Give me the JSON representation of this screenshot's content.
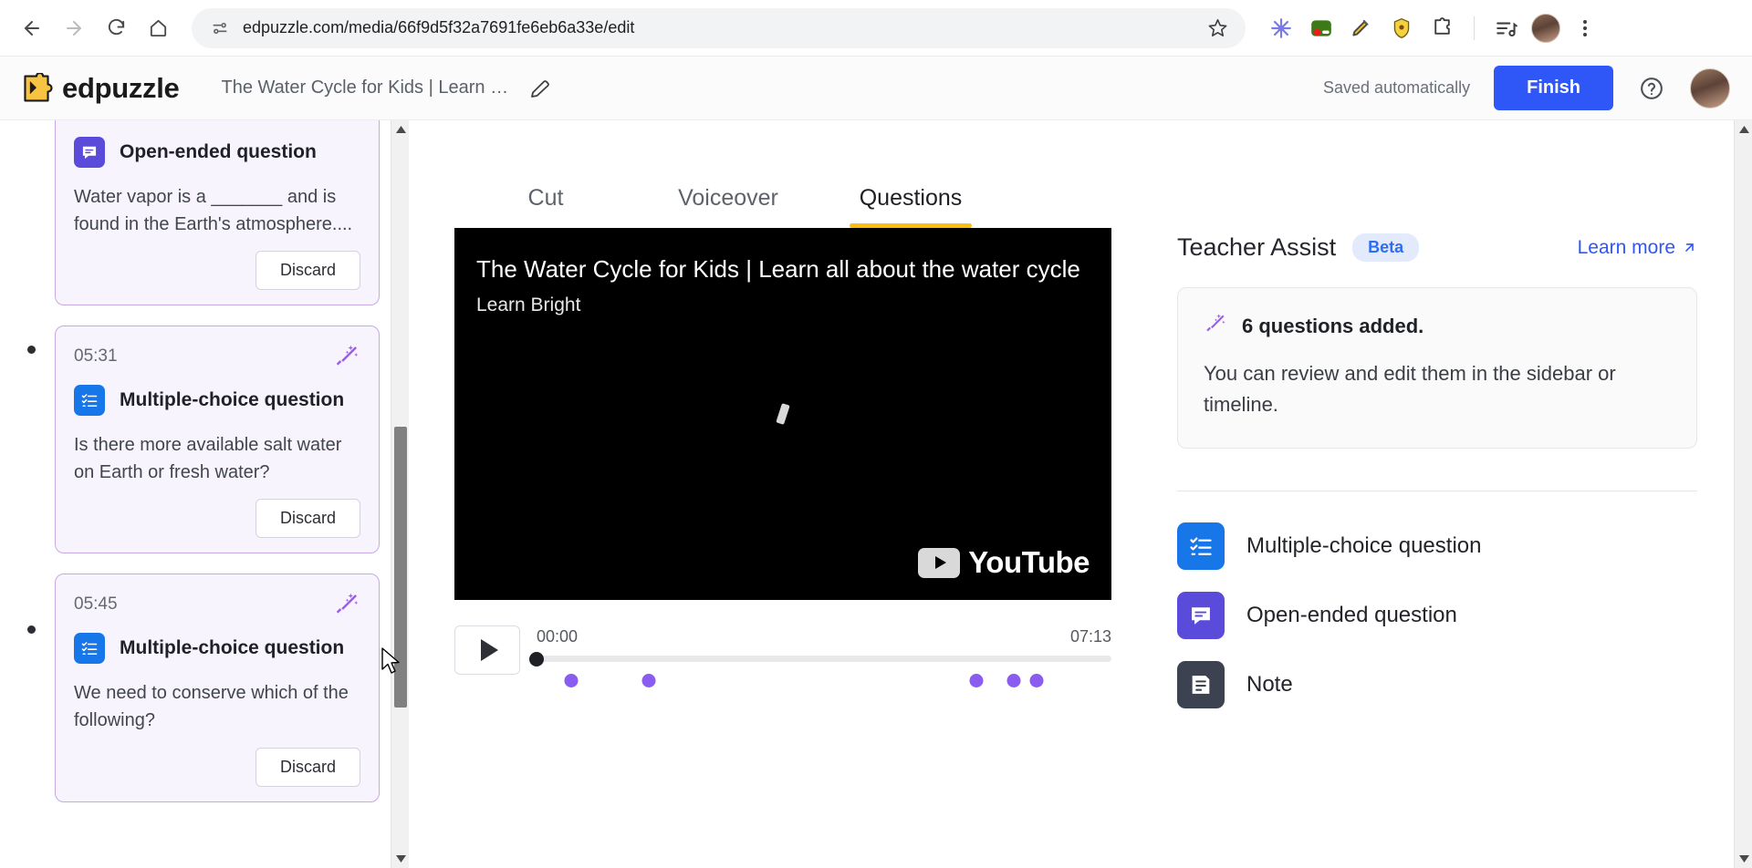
{
  "browser": {
    "url": "edpuzzle.com/media/66f9d5f32a7691fe6eb6a33e/edit",
    "back_icon": "back-arrow-icon",
    "forward_icon": "forward-arrow-icon",
    "reload_icon": "reload-icon",
    "home_icon": "home-icon",
    "site_info_icon": "site-settings-icon",
    "bookmark_icon": "star-icon",
    "extensions": [
      {
        "name": "asterisk-extension-icon",
        "color": "#7a7ae6"
      },
      {
        "name": "green-recorder-extension-icon",
        "color": "#2f6d13"
      },
      {
        "name": "highlighter-extension-icon",
        "color": "#f0c419"
      },
      {
        "name": "shield-extension-icon",
        "color": "#f5d142"
      },
      {
        "name": "extensions-puzzle-icon",
        "color": "#4a4a4a"
      },
      {
        "name": "reading-list-icon",
        "color": "#3c4043"
      }
    ],
    "profile_icon": "profile-avatar",
    "menu_icon": "three-dot-menu-icon"
  },
  "header": {
    "brand": "edpuzzle",
    "logo_icon": "edpuzzle-logo-icon",
    "video_title": "The Water Cycle for Kids | Learn …",
    "edit_icon": "pencil-edit-icon",
    "saved_status": "Saved automatically",
    "finish_label": "Finish",
    "help_icon": "help-question-icon",
    "avatar_icon": "user-avatar"
  },
  "sidebar": {
    "cards": [
      {
        "time": "",
        "type_label": "Open-ended question",
        "type_key": "open",
        "type_icon": "speech-bubble-icon",
        "text": "Water vapor is a _______ and is found in the Earth's atmosphere....",
        "discard_label": "Discard",
        "magic_icon": "magic-wand-icon",
        "clipped": true
      },
      {
        "time": "05:31",
        "type_label": "Multiple-choice question",
        "type_key": "mcq",
        "type_icon": "checklist-icon",
        "text": "Is there more available salt water on Earth or fresh water?",
        "discard_label": "Discard",
        "magic_icon": "magic-wand-icon",
        "clipped": false
      },
      {
        "time": "05:45",
        "type_label": "Multiple-choice question",
        "type_key": "mcq",
        "type_icon": "checklist-icon",
        "text": "We need to conserve which of the following?",
        "discard_label": "Discard",
        "magic_icon": "magic-wand-icon",
        "clipped": false
      }
    ],
    "scroll_up_icon": "scroll-up-arrow-icon",
    "scroll_down_icon": "scroll-down-arrow-icon"
  },
  "tabs": [
    {
      "label": "Cut",
      "active": false
    },
    {
      "label": "Voiceover",
      "active": false
    },
    {
      "label": "Questions",
      "active": true
    }
  ],
  "player": {
    "video_title": "The Water Cycle for Kids | Learn all about the water cycle",
    "channel": "Learn Bright",
    "youtube_label": "YouTube",
    "play_icon": "play-triangle-icon",
    "current_time": "00:00",
    "duration": "07:13",
    "progress_percent": 0,
    "markers_percent": [
      6,
      19.5,
      76.5,
      83,
      87
    ]
  },
  "assist": {
    "title": "Teacher Assist",
    "badge": "Beta",
    "learn_more": "Learn more",
    "learn_more_icon": "external-link-icon",
    "box": {
      "icon": "magic-wand-icon",
      "title": "6 questions added.",
      "body": "You can review and edit them in the sidebar or timeline."
    },
    "types": [
      {
        "label": "Multiple-choice question",
        "key": "mcq",
        "icon": "checklist-icon"
      },
      {
        "label": "Open-ended question",
        "key": "open",
        "icon": "speech-bubble-icon"
      },
      {
        "label": "Note",
        "key": "note",
        "icon": "note-icon"
      }
    ]
  },
  "colors": {
    "accent_blue": "#2f56f7",
    "tab_underline": "#f9bd15",
    "purple_marker": "#8b5cf0",
    "card_border": "#c7a8e4",
    "card_bg": "#f8f4fd"
  }
}
